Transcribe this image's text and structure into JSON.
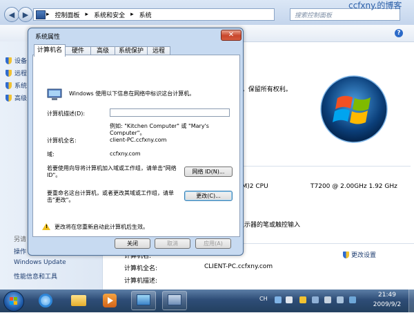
{
  "explorer": {
    "breadcrumb": [
      "控制面板",
      "系统和安全",
      "系统"
    ],
    "search_placeholder": "搜索控制面板",
    "watermark": "ccfxny.的博客",
    "help": "?",
    "left_items": [
      "设备",
      "远程",
      "系统",
      "高级"
    ],
    "see_also": "另请",
    "left_links": [
      "操作",
      "Windows Update",
      "性能信息和工具"
    ],
    "copyright_tail": "n。保留所有权利。",
    "cpu_model": "TM)2 CPU",
    "cpu_speed": "T7200  @ 2.00GHz   1.92 GHz",
    "pen_input": "显示器的笔或触控输入",
    "change_settings": "更改设置",
    "rows": [
      {
        "label": "计算机名:",
        "value": "CLIENT-PC"
      },
      {
        "label": "计算机全名:",
        "value": "CLIENT-PC.ccfxny.com"
      },
      {
        "label": "计算机描述:",
        "value": ""
      }
    ]
  },
  "dialog": {
    "title": "系统属性",
    "close": "✕",
    "tabs": [
      "计算机名",
      "硬件",
      "高级",
      "系统保护",
      "远程"
    ],
    "active_tab": 0,
    "intro": "Windows 使用以下信息在网络中标识这台计算机。",
    "desc_label": "计算机描述(D):",
    "desc_value": "",
    "example": "例如: \"Kitchen Computer\" 或 \"Mary's Computer\"。",
    "fullname_label": "计算机全名:",
    "fullname_value": "client-PC.ccfxny.com",
    "domain_label": "域:",
    "domain_value": "ccfxny.com",
    "network_text": "若要使用向导将计算机加入域或工作组，请单击\"网络 ID\"。",
    "network_id_btn": "网络 ID(N)...",
    "rename_text": "要重命名这台计算机，或者更改其域或工作组，请单击\"更改\"。",
    "change_btn": "更改(C)...",
    "warning": "更改将在您重新启动此计算机后生效。",
    "ok": "关闭",
    "cancel": "取消",
    "apply": "应用(A)"
  },
  "taskbar": {
    "lang": "CH",
    "time": "21:49",
    "date": "2009/9/2"
  },
  "colors": {
    "accent": "#2c6ac8",
    "dialog_frame": "#c7daf1",
    "taskbar": "#2e4d77",
    "close_button": "#c8452b"
  }
}
